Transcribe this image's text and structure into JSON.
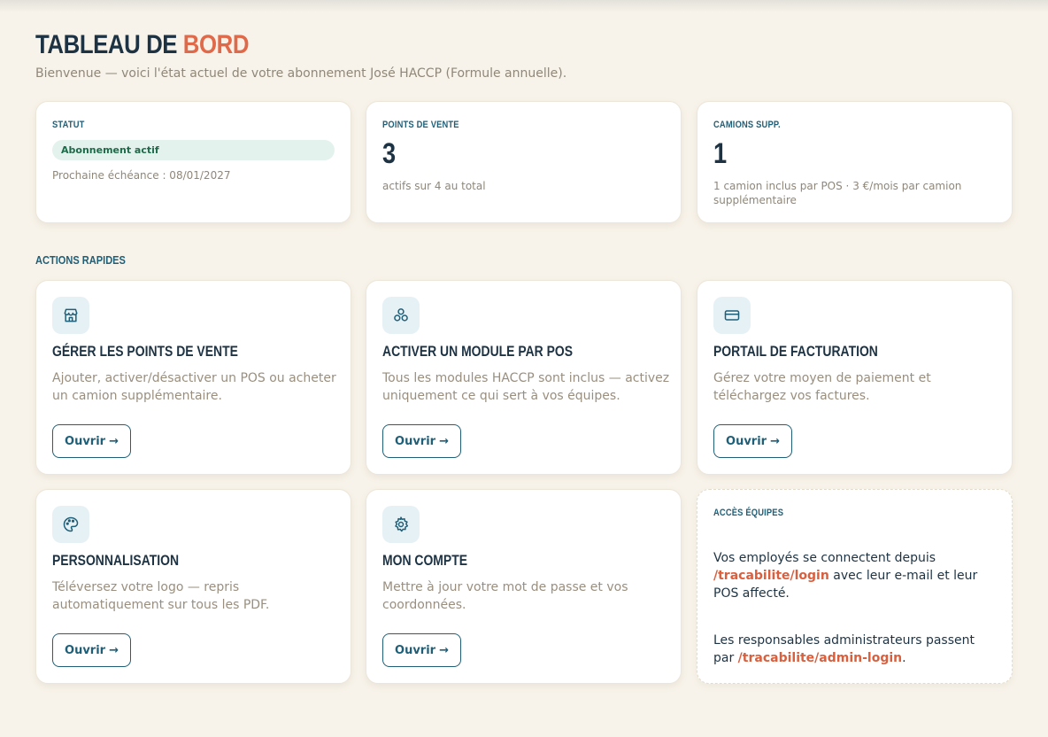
{
  "header": {
    "title_part1": "TABLEAU DE ",
    "title_part2": "BORD",
    "subtitle": "Bienvenue — voici l'état actuel de votre abonnement José HACCP (Formule annuelle)."
  },
  "stats": {
    "statut": {
      "label": "STATUT",
      "badge": "Abonnement actif",
      "note": "Prochaine échéance : 08/01/2027"
    },
    "points_de_vente": {
      "label": "POINTS DE VENTE",
      "value": "3",
      "note": "actifs sur 4 au total"
    },
    "camions": {
      "label": "CAMIONS SUPP.",
      "value": "1",
      "note": "1 camion inclus par POS · 3 €/mois par camion supplémentaire"
    }
  },
  "quick_actions": {
    "label": "ACTIONS RAPIDES",
    "open_label": "Ouvrir",
    "arrow": "→",
    "items": [
      {
        "title": "GÉRER LES POINTS DE VENTE",
        "desc": "Ajouter, activer/désactiver un POS ou acheter un camion supplémentaire.",
        "icon": "store-icon"
      },
      {
        "title": "ACTIVER UN MODULE PAR POS",
        "desc": "Tous les modules HACCP sont inclus — activez uniquement ce qui sert à vos équipes.",
        "icon": "modules-icon"
      },
      {
        "title": "PORTAIL DE FACTURATION",
        "desc": "Gérez votre moyen de paiement et téléchargez vos factures.",
        "icon": "credit-card-icon"
      },
      {
        "title": "PERSONNALISATION",
        "desc": "Téléversez votre logo — repris automatiquement sur tous les PDF.",
        "icon": "palette-icon"
      },
      {
        "title": "MON COMPTE",
        "desc": "Mettre à jour votre mot de passe et vos coordonnées.",
        "icon": "gear-icon"
      }
    ]
  },
  "team_access": {
    "label": "ACCÈS ÉQUIPES",
    "p1_before": "Vos employés se connectent depuis ",
    "p1_link": "/tracabilite/login",
    "p1_after": " avec leur e-mail et leur POS affecté.",
    "p2_before": "Les responsables administrateurs passent par ",
    "p2_link": "/tracabilite/admin-login",
    "p2_after": "."
  },
  "colors": {
    "background": "#f8f3ea",
    "primary": "#1f5f78",
    "accent": "#e0694a",
    "badge_bg": "#e3f2ec"
  }
}
